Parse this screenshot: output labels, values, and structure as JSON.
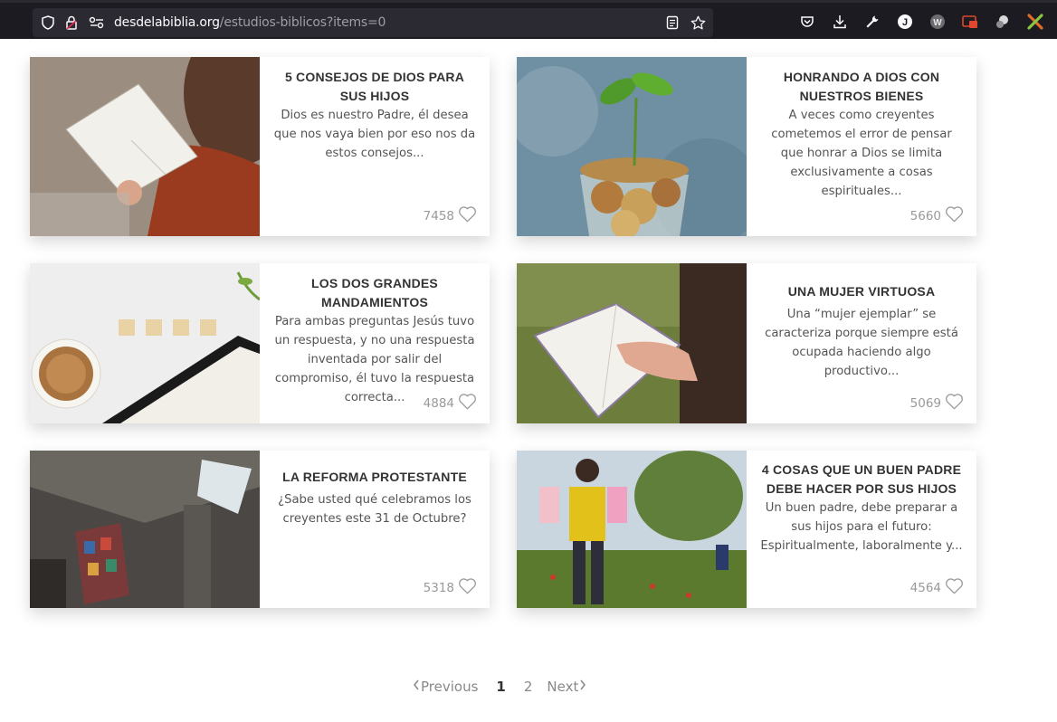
{
  "browser": {
    "url_domain": "desdelabiblia.org",
    "url_path": "/estudios-biblicos?items=0",
    "icons": [
      "shield-icon",
      "lock-warning-icon",
      "permissions-icon",
      "reader-view-icon",
      "bookmark-star-icon",
      "pocket-icon",
      "download-icon",
      "wrench-icon",
      "extension-j-icon",
      "extension-w-icon",
      "extension-red-icon",
      "extension-puzzle-icon",
      "extension-x-icon"
    ]
  },
  "cards": [
    {
      "title": "5 CONSEJOS DE DIOS PARA SUS HIJOS",
      "desc": "Dios es nuestro Padre, él desea que nos vaya bien por eso nos da estos consejos...",
      "count": "7458",
      "image": "woman-reading-bible"
    },
    {
      "title": "HONRANDO A DIOS CON NUESTROS BIENES",
      "desc": "A veces como creyentes cometemos el error de pensar que honrar a Dios se limita exclusivamente a cosas espirituales...",
      "count": "5660",
      "image": "plant-in-coins-jar"
    },
    {
      "title": "LOS DOS GRANDES MANDAMIENTOS",
      "desc": "Para ambas preguntas Jesús tuvo un respuesta, y no una respuesta inventada por salir del compromiso, él tuvo la respuesta correcta...",
      "count": "4884",
      "image": "love-coffee-bible"
    },
    {
      "title": "UNA MUJER VIRTUOSA",
      "desc": "Una “mujer ejemplar” se caracteriza porque siempre está ocupada haciendo algo productivo...",
      "count": "5069",
      "image": "hand-on-bible"
    },
    {
      "title": "LA REFORMA PROTESTANTE",
      "desc": "¿Sabe usted qué celebramos los creyentes este 31 de Octubre?",
      "count": "5318",
      "image": "cathedral-interior"
    },
    {
      "title": "4 COSAS QUE UN BUEN PADRE DEBE HACER POR SUS HIJOS",
      "desc": "Un buen padre, debe preparar a sus hijos para el futuro: Espiritualmente, laboralmente y...",
      "count": "4564",
      "image": "father-carrying-kids"
    }
  ],
  "pagination": {
    "previous": "Previous",
    "pages": [
      "1",
      "2"
    ],
    "current": "1",
    "next": "Next"
  }
}
